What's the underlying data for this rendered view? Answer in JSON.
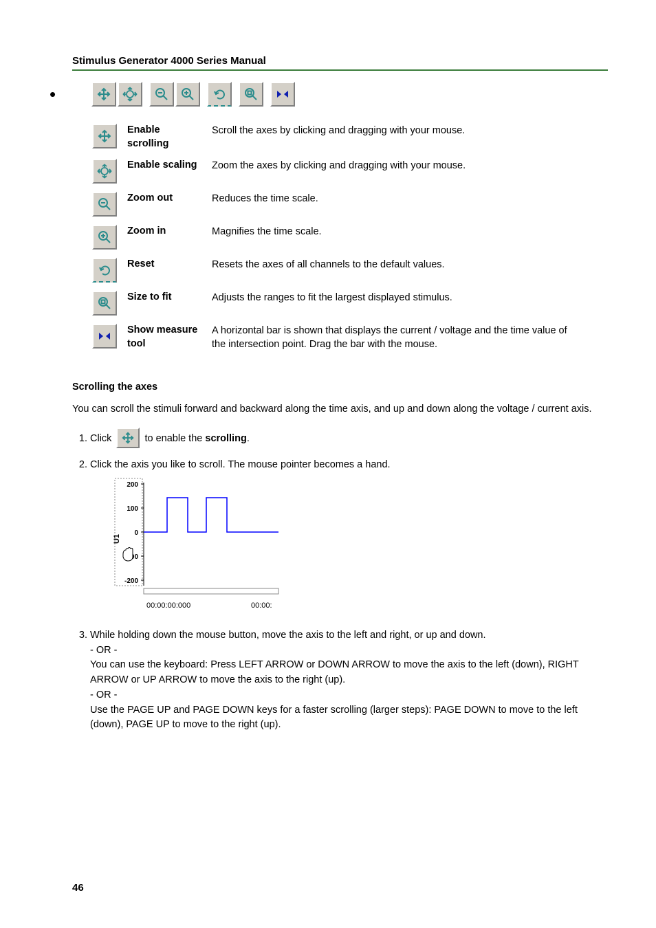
{
  "header": {
    "title": "Stimulus Generator 4000 Series Manual"
  },
  "toolbar": {
    "items": [
      {
        "name": "Enable scrolling",
        "desc": "Scroll the axes by clicking and dragging with your mouse.",
        "icon": "move-icon"
      },
      {
        "name": "Enable scaling",
        "desc": "Zoom the axes by clicking and dragging with your mouse.",
        "icon": "scale-icon"
      },
      {
        "name": "Zoom out",
        "desc": "Reduces the time scale.",
        "icon": "zoom-out-icon"
      },
      {
        "name": "Zoom in",
        "desc": "Magnifies the time scale.",
        "icon": "zoom-in-icon"
      },
      {
        "name": "Reset",
        "desc": "Resets the axes of all channels to the default values.",
        "icon": "reset-icon"
      },
      {
        "name": "Size to fit",
        "desc": "Adjusts the ranges to fit the largest displayed stimulus.",
        "icon": "size-to-fit-icon"
      },
      {
        "name": "Show measure tool",
        "desc": "A horizontal bar is shown that displays the current / voltage and the time value of the intersection point. Drag the bar with the mouse.",
        "icon": "measure-icon"
      }
    ]
  },
  "section": {
    "subhead": "Scrolling the axes",
    "intro": "You can scroll the stimuli forward and backward along the time axis, and up and down along the voltage / current axis.",
    "step1_pre": "Click ",
    "step1_post": " to enable the ",
    "step1_bold": "scrolling",
    "step1_end": ".",
    "step2": "Click the axis you like to scroll. The mouse pointer becomes a hand.",
    "step3_line1": "While holding down the mouse button, move the axis to the left and right, or up and down.",
    "step3_or": "- OR -",
    "step3_line2": "You can use the keyboard: Press LEFT ARROW or DOWN ARROW to move the axis to the left (down), RIGHT ARROW or UP ARROW to move the axis to the right (up).",
    "step3_line3": "Use the PAGE UP and PAGE DOWN keys for a faster scrolling (larger steps): PAGE DOWN to move to the left (down), PAGE UP to move to the right (up)."
  },
  "chart_data": {
    "type": "line",
    "title": "",
    "ylabel": "U1",
    "xlabel": "",
    "xticks": [
      "00:00:00:000",
      "00:00:"
    ],
    "yticks": [
      -200,
      -100,
      0,
      100,
      200
    ],
    "ylim": [
      -200,
      200
    ],
    "series": [
      {
        "name": "stimulus",
        "color": "#0000ff"
      }
    ],
    "annotations": [
      {
        "type": "hand-cursor",
        "approx_y": -100
      }
    ]
  },
  "page_number": "46"
}
